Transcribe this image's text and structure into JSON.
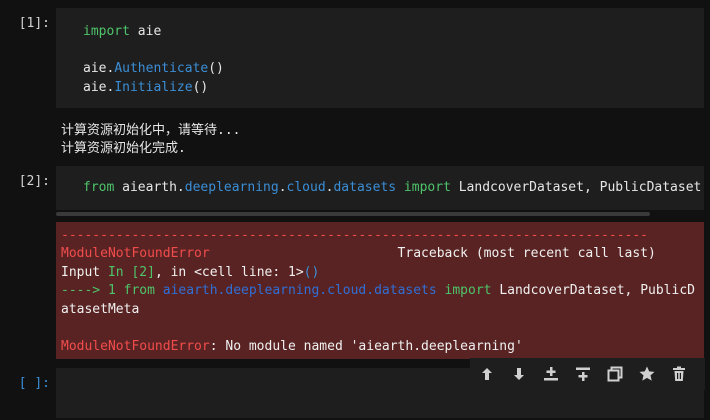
{
  "cells": {
    "c1": {
      "prompt": "[1]:",
      "line1": {
        "kw": "import",
        "mod": " aie"
      },
      "line2": {
        "obj": "aie.",
        "fn": "Authenticate",
        "rest": "()"
      },
      "line3": {
        "obj": "aie.",
        "fn": "Initialize",
        "rest": "()"
      },
      "output": [
        "计算资源初始化中，请等待...",
        "计算资源初始化完成."
      ]
    },
    "c2": {
      "prompt": "[2]:",
      "code": {
        "from": "from",
        "m1": " aiearth.",
        "m2": "deeplearning",
        "m3": ".",
        "m4": "cloud",
        "m5": ".",
        "m6": "datasets",
        "imp": " import",
        "names": " LandcoverDataset, PublicDataset"
      },
      "error": {
        "dashes": "---------------------------------------------------------------------------",
        "err_name": "ModuleNotFoundError",
        "traceback": "                        Traceback (most recent call last)",
        "input_label": "Input ",
        "in_label": "In [2]",
        "in_rest": ", in ",
        "cell_line": "<cell line: 1>",
        "paren": "()",
        "arrow": "----> 1",
        "from": " from",
        "module": " aiearth.deeplearning.cloud.datasets",
        "imp": " import",
        "names": " LandcoverDataset, PublicD",
        "wrap": "atasetMeta",
        "final_name": "ModuleNotFoundError",
        "final_msg": ": No module named 'aiearth.deeplearning'"
      }
    },
    "c3": {
      "prompt": "[ ]:"
    }
  },
  "toolbar": {
    "buttons": [
      "move-up-icon",
      "move-down-icon",
      "insert-above-icon",
      "insert-below-icon",
      "duplicate-icon",
      "star-icon",
      "trash-icon"
    ]
  },
  "colors": {
    "background": "#111111",
    "cell": "#1e1e1e",
    "error_bg": "#5a2323",
    "keyword": "#4ec46a",
    "function": "#3b8ed6"
  }
}
